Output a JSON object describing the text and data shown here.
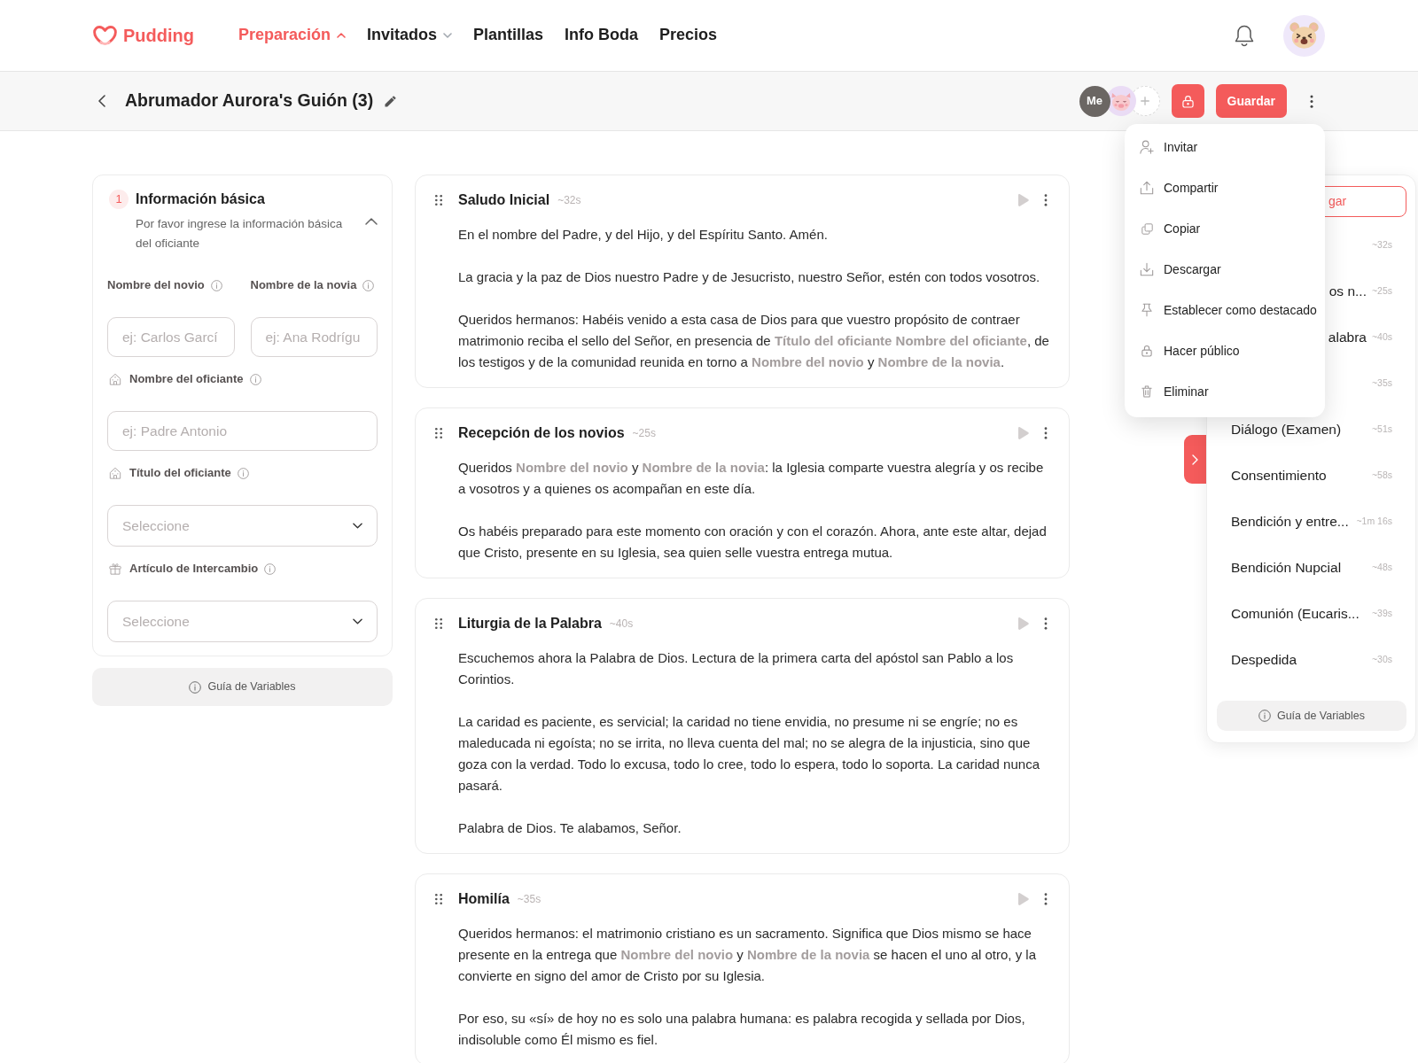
{
  "navbar": {
    "logo": "Pudding",
    "items": [
      {
        "label": "Preparación",
        "selected": true,
        "has_menu": true,
        "expanded": true
      },
      {
        "label": "Invitados",
        "selected": false,
        "has_menu": true,
        "expanded": false
      },
      {
        "label": "Plantillas",
        "selected": false,
        "has_menu": false
      },
      {
        "label": "Info Boda",
        "selected": false,
        "has_menu": false
      },
      {
        "label": "Precios",
        "selected": false,
        "has_menu": false
      }
    ]
  },
  "header": {
    "title": "Abrumador Aurora's Guión (3)",
    "collaborators": [
      {
        "kind": "initials",
        "label": "Me"
      },
      {
        "kind": "avatar"
      }
    ],
    "save_button": "Guardar",
    "more_menu": {
      "expanded": true,
      "items": [
        {
          "kind": "invite",
          "label": "Invitar"
        },
        {
          "kind": "share",
          "label": "Compartir"
        },
        {
          "kind": "copy",
          "label": "Copiar"
        },
        {
          "kind": "download",
          "label": "Descargar"
        },
        {
          "kind": "pin",
          "label": "Establecer como destacado"
        },
        {
          "kind": "public",
          "label": "Hacer público"
        },
        {
          "kind": "delete",
          "label": "Eliminar"
        }
      ]
    }
  },
  "basic_info": {
    "step": "1",
    "title": "Información básica",
    "subtitle": "Por favor ingrese la información básica del oficiante",
    "expanded": true,
    "fields": [
      {
        "kind": "half-input",
        "label": "Nombre del novio",
        "placeholder": "ej: Carlos Garcí"
      },
      {
        "kind": "half-input",
        "label": "Nombre de la novia",
        "placeholder": "ej: Ana Rodrígu"
      },
      {
        "kind": "officiant-input",
        "label": "Nombre del oficiante",
        "placeholder": "ej: Padre Antonio"
      },
      {
        "kind": "officiant-select",
        "label": "Título del oficiante",
        "placeholder": "Seleccione"
      },
      {
        "kind": "exchange-select",
        "label": "Artículo de Intercambio",
        "placeholder": "Seleccione"
      }
    ],
    "guide_button": "Guía de Variables"
  },
  "sections": [
    {
      "title": "Saludo Inicial",
      "duration": "~32s",
      "paragraphs": [
        "En el nombre del Padre, y del Hijo, y del Espíritu Santo. Amén.",
        "La gracia y la paz de Dios nuestro Padre y de Jesucristo, nuestro Señor, estén con todos vosotros.",
        "Queridos hermanos: Habéis venido a esta casa de Dios para que vuestro propósito de contraer matrimonio reciba el sello del Señor, en presencia de **Título del oficiante Nombre del oficiante**, de los testigos y de la comunidad reunida en torno a **Nombre del novio** y **Nombre de la novia**."
      ]
    },
    {
      "title": "Recepción de los novios",
      "duration": "~25s",
      "paragraphs": [
        "Queridos **Nombre del novio** y **Nombre de la novia**: la Iglesia comparte vuestra alegría y os recibe a vosotros y a quienes os acompañan en este día.",
        "Os habéis preparado para este momento con oración y con el corazón. Ahora, ante este altar, dejad que Cristo, presente en su Iglesia, sea quien selle vuestra entrega mutua."
      ]
    },
    {
      "title": "Liturgia de la Palabra",
      "duration": "~40s",
      "paragraphs": [
        "Escuchemos ahora la Palabra de Dios. Lectura de la primera carta del apóstol san Pablo a los Corintios.",
        "La caridad es paciente, es servicial; la caridad no tiene envidia, no presume ni se engríe; no es maleducada ni egoísta; no se irrita, no lleva cuenta del mal; no se alegra de la injusticia, sino que goza con la verdad. Todo lo excusa, todo lo cree, todo lo espera, todo lo soporta. La caridad nunca pasará.",
        "Palabra de Dios. Te alabamos, Señor."
      ]
    },
    {
      "title": "Homilía",
      "duration": "~35s",
      "paragraphs": [
        "Queridos hermanos: el matrimonio cristiano es un sacramento. Significa que Dios mismo se hace presente en la entrega que **Nombre del novio** y **Nombre de la novia** se hacen el uno al otro, y la convierte en signo del amor de Cristo por su Iglesia.",
        "Por eso, su «sí» de hoy no es solo una palabra humana: es palabra recogida y sellada por Dios, indisoluble como Él mismo es fiel."
      ]
    }
  ],
  "outline": {
    "add_button": {
      "label": "gar",
      "covered": true
    },
    "items": [
      {
        "duration": "~32s"
      },
      {
        "label": "os n...",
        "covered": true,
        "duration": "~25s"
      },
      {
        "label": "alabra",
        "covered": true,
        "duration": "~40s"
      },
      {
        "duration": "~35s"
      },
      {
        "label": "Diálogo (Examen)",
        "covered": false,
        "duration": "~51s"
      },
      {
        "label": "Consentimiento",
        "covered": false,
        "duration": "~58s"
      },
      {
        "label": "Bendición y entre...",
        "covered": false,
        "duration": "~1m 16s"
      },
      {
        "label": "Bendición Nupcial",
        "covered": false,
        "duration": "~48s"
      },
      {
        "label": "Comunión (Eucaris...",
        "covered": false,
        "duration": "~39s"
      },
      {
        "label": "Despedida",
        "covered": false,
        "duration": "~30s"
      }
    ],
    "guide_button": "Guía de Variables"
  }
}
